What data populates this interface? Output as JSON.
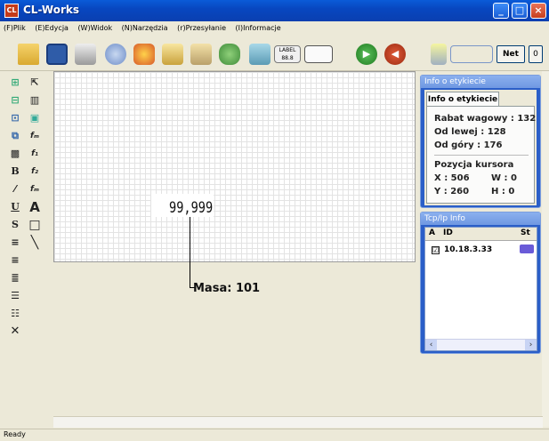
{
  "window": {
    "title": "CL-Works",
    "app_icon": "app-icon",
    "minimize": "_",
    "maximize": "□",
    "close": "×"
  },
  "menu": {
    "items": [
      "(F)Plik",
      "(E)Edycja",
      "(W)Widok",
      "(N)Narzędzia",
      "(r)Przesyłanie",
      "(I)Informacje"
    ]
  },
  "toolbar": {
    "keyboard_label": "LABEL 88.8",
    "net_label": "Net",
    "zero_label": "0",
    "forward_glyph": "▶",
    "back_glyph": "◀"
  },
  "palette": {
    "bold_glyph": "B",
    "underline_glyph": "U",
    "strike_glyph": "S",
    "text_glyph": "A",
    "close_glyph": "✕"
  },
  "canvas": {
    "value_text": "99,999",
    "annotation": "Masa:  101"
  },
  "info_panel": {
    "header": "Info o etykiecie",
    "tab": "Info o etykiecie",
    "rabat_label": "Rabat wagowy : 132",
    "left_label": "Od lewej : 128",
    "top_label": "Od góry : 176",
    "cursor_header": "Pozycja kursora",
    "x_label": "X : 506",
    "w_label": "W : 0",
    "y_label": "Y : 260",
    "h_label": "H : 0"
  },
  "tcp_panel": {
    "header": "Tcp/Ip Info",
    "col_a": "A",
    "col_id": "ID",
    "col_st": "St",
    "rows": [
      {
        "checked": "☑",
        "id": "10.18.3.33"
      }
    ]
  },
  "status": {
    "text": "Ready"
  }
}
